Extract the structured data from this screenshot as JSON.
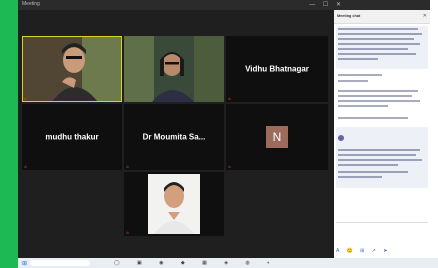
{
  "window": {
    "title": "Meeting",
    "controls": "—  ☐  ✕"
  },
  "participants": [
    {
      "name": "",
      "has_video": true,
      "speaking": true,
      "mic_muted": true
    },
    {
      "name": "",
      "has_video": true,
      "speaking": false,
      "mic_muted": true
    },
    {
      "name": "Vidhu Bhatnagar",
      "has_video": false,
      "speaking": false,
      "mic_muted": true
    },
    {
      "name": "mudhu thakur",
      "has_video": false,
      "speaking": false,
      "mic_muted": true
    },
    {
      "name": "Dr Moumita Sa...",
      "has_video": false,
      "speaking": false,
      "mic_muted": true
    },
    {
      "name": "",
      "initial": "N",
      "has_video": false,
      "speaking": false,
      "mic_muted": true
    },
    {
      "name": "",
      "has_video": true,
      "speaking": false,
      "mic_muted": true
    }
  ],
  "chat": {
    "title": "Meeting chat",
    "close": "✕",
    "messages": [
      {
        "text": "",
        "highlighted": true
      },
      {
        "text": "",
        "highlighted": false
      },
      {
        "text": "",
        "highlighted": false
      },
      {
        "text": "",
        "highlighted": false
      },
      {
        "text": "",
        "highlighted": false
      },
      {
        "text": "",
        "highlighted": true
      }
    ],
    "send_to": "",
    "placeholder": "",
    "tools": "A 😊 ⊞ ↗ ➤"
  },
  "taskbar": {
    "start": "⊞",
    "search": "",
    "apps": "◯ ▣ ◉ ◆ ▦ ◈ ◍ ◐",
    "clock": ""
  },
  "colors": {
    "accent_bar": "#1db954",
    "meeting_bg": "#1f1f1f",
    "speaking_outline": "#d9d423",
    "avatar_n": "#9c6b5b",
    "chat_bubble": "#eef0f8"
  }
}
